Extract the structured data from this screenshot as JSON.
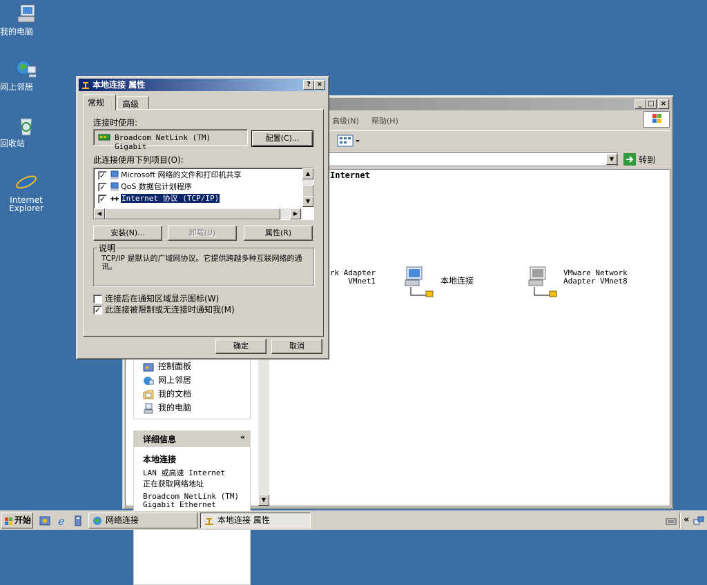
{
  "desktop": {
    "icons": [
      {
        "label": "我的电脑"
      },
      {
        "label": "网上邻居"
      },
      {
        "label": "回收站"
      },
      {
        "label": "Internet Explorer"
      }
    ]
  },
  "explorer": {
    "menus": {
      "advanced": "高级(N)",
      "help": "帮助(H)"
    },
    "go_label": "转到",
    "content_header": "Internet",
    "connections": [
      {
        "label": "VMware Network Adapter VMnet1"
      },
      {
        "label": "本地连接"
      },
      {
        "label": "VMware Network Adapter VMnet8"
      }
    ],
    "other_places": [
      "控制面板",
      "网上邻居",
      "我的文档",
      "我的电脑"
    ],
    "details": {
      "heading": "详细信息",
      "name": "本地连接",
      "type": "LAN 或高速 Internet",
      "status": "正在获取网络地址",
      "device": "Broadcom NetLink (TM) Gigabit Ethernet"
    }
  },
  "dialog": {
    "title": "本地连接 属性",
    "tabs": [
      "常规",
      "高级"
    ],
    "connect_using_label": "连接时使用:",
    "adapter_name": "Broadcom NetLink (TM) Gigabit",
    "configure_button": "配置(C)...",
    "items_label": "此连接使用下列项目(O):",
    "items": [
      {
        "label": "Microsoft 网络的文件和打印机共享",
        "checked": true
      },
      {
        "label": "QoS 数据包计划程序",
        "checked": true
      },
      {
        "label": "Internet 协议 (TCP/IP)",
        "checked": true
      }
    ],
    "install_button": "安装(N)...",
    "uninstall_button": "卸载(U)",
    "properties_button": "属性(R)",
    "description_group": "说明",
    "description": "TCP/IP 是默认的广域网协议。它提供跨越多种互联网络的通讯。",
    "show_icon_label": "连接后在通知区域显示图标(W)",
    "show_icon_checked": false,
    "notify_label": "此连接被限制或无连接时通知我(M)",
    "notify_checked": true,
    "ok_button": "确定",
    "cancel_button": "取消"
  },
  "taskbar": {
    "start_label": "开始",
    "tasks": [
      {
        "label": "网络连接"
      },
      {
        "label": "本地连接 属性"
      }
    ]
  }
}
